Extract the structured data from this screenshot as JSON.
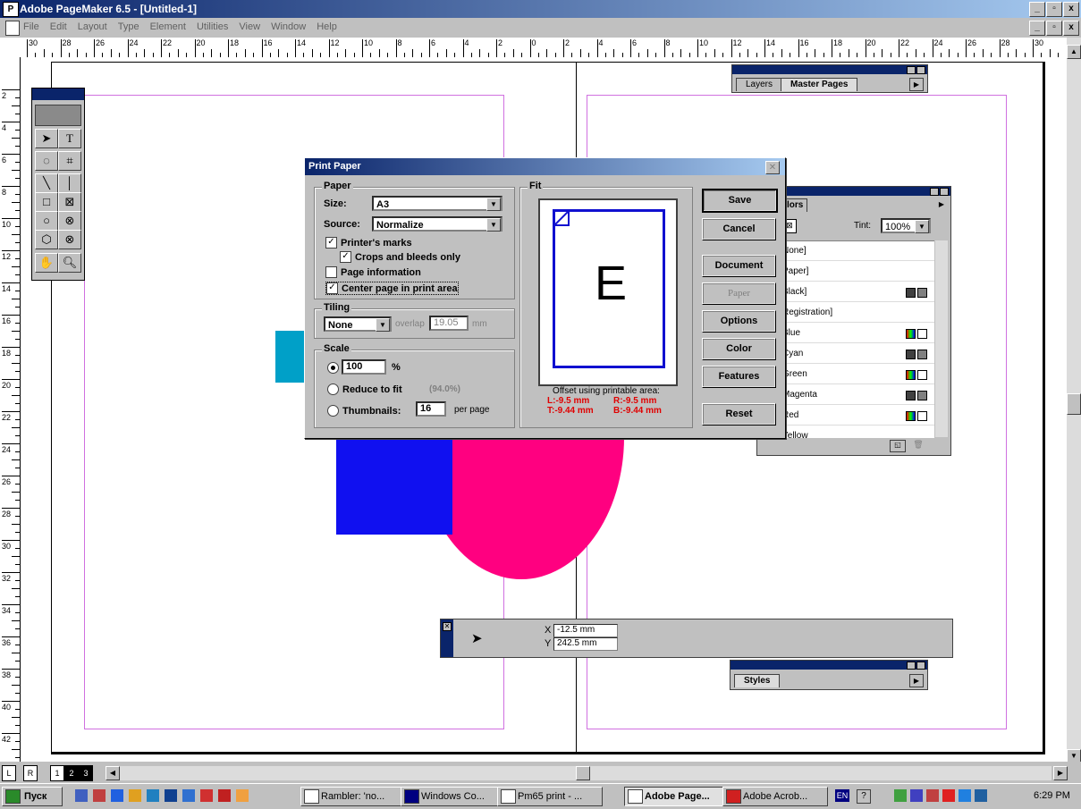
{
  "window": {
    "title": "Adobe PageMaker 6.5 - [Untitled-1]",
    "app_icon": "P",
    "min": "_",
    "max": "▫",
    "close": "x"
  },
  "menu": [
    "File",
    "Edit",
    "Layout",
    "Type",
    "Element",
    "Utilities",
    "View",
    "Window",
    "Help"
  ],
  "ruler": {
    "h_labels": [
      "30",
      "28",
      "26",
      "24",
      "22",
      "20",
      "18",
      "16",
      "14",
      "12",
      "10",
      "8",
      "6",
      "4",
      "2",
      "0",
      "2",
      "4",
      "6",
      "8",
      "10",
      "12",
      "14",
      "16",
      "18",
      "20",
      "22",
      "24",
      "26",
      "28",
      "30"
    ],
    "v_labels": [
      "2",
      "4",
      "6",
      "8",
      "10",
      "12",
      "14",
      "16",
      "18",
      "20",
      "22",
      "24",
      "26",
      "28",
      "30",
      "32",
      "34",
      "36",
      "38",
      "40",
      "42"
    ]
  },
  "colors": {
    "cyan_shape": "#00a0c8",
    "blue_shape": "#1010f0",
    "magenta_shape": "#ff0080",
    "margin": "#d070e0"
  },
  "dialog": {
    "title": "Print Paper",
    "paper_group": "Paper",
    "size_label": "Size:",
    "size_value": "A3",
    "source_label": "Source:",
    "source_value": "Normalize",
    "printers_marks": "Printer's marks",
    "crops_only": "Crops and bleeds only",
    "page_info": "Page information",
    "center_page": "Center page in print area",
    "tiling_group": "Tiling",
    "tiling_value": "None",
    "overlap_label": "overlap",
    "overlap_value": "19.05",
    "overlap_unit": "mm",
    "scale_group": "Scale",
    "scale_value": "100",
    "scale_unit": "%",
    "reduce_label": "Reduce to fit",
    "reduce_value": "(94.0%)",
    "thumbnails_label": "Thumbnails:",
    "thumbnails_value": "16",
    "per_page": "per page",
    "fit_group": "Fit",
    "preview_letter": "E",
    "offset_label": "Offset using printable area:",
    "offset_l": "L:-9.5 mm",
    "offset_r": "R:-9.5 mm",
    "offset_t": "T:-9.44 mm",
    "offset_b": "B:-9.44 mm",
    "buttons": {
      "save": "Save",
      "cancel": "Cancel",
      "document": "Document",
      "paper": "Paper",
      "options": "Options",
      "color": "Color",
      "features": "Features",
      "reset": "Reset"
    }
  },
  "layers_panel": {
    "tab_layers": "Layers",
    "tab_master": "Master Pages"
  },
  "colors_panel": {
    "tab": "lors",
    "tint_label": "Tint:",
    "tint_value": "100%",
    "items": [
      "None]",
      "Paper]",
      "Black]",
      "Registration]",
      "Blue",
      "Cyan",
      "Green",
      "Magenta",
      "Red",
      "Yellow"
    ]
  },
  "control_palette": {
    "x_label": "X",
    "x_value": "-12.5 mm",
    "y_label": "Y",
    "y_value": "242.5 mm"
  },
  "styles_panel": {
    "tab": "Styles"
  },
  "page_tabs": {
    "l": "L",
    "r": "R",
    "p1": "1",
    "p2": "2",
    "p3": "3"
  },
  "taskbar": {
    "start": "Пуск",
    "tasks": [
      "Rambler: 'no...",
      "Windows Co...",
      "Pm65 print - ...",
      "Adobe Page...",
      "Adobe Acrob..."
    ],
    "lang": "EN",
    "clock": "6:29 PM"
  }
}
